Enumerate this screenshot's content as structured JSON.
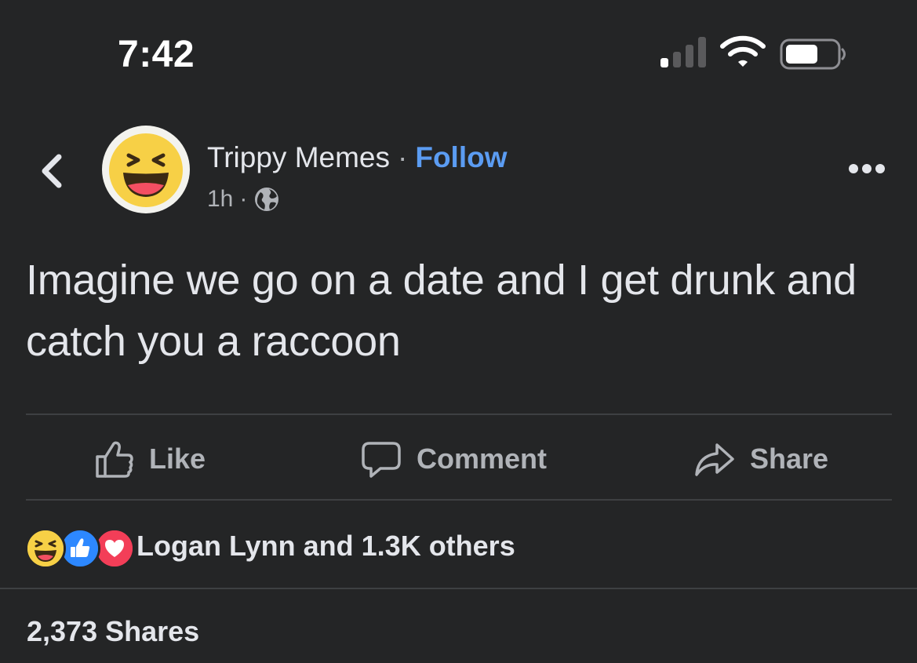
{
  "status_bar": {
    "time": "7:42",
    "icons": [
      "cellular-signal-icon",
      "wifi-icon",
      "battery-icon"
    ]
  },
  "post": {
    "author": "Trippy Memes",
    "separator": "·",
    "follow_label": "Follow",
    "time": "1h",
    "meta_separator": "·",
    "privacy_icon": "globe-icon",
    "avatar_icon": "laughing-emoji-icon",
    "text": "Imagine we go on a date and I get drunk and catch you a raccoon"
  },
  "actions": {
    "like_label": "Like",
    "comment_label": "Comment",
    "share_label": "Share"
  },
  "reactions": {
    "types": [
      "haha-reaction-icon",
      "like-reaction-icon",
      "love-reaction-icon"
    ],
    "summary": "Logan Lynn and 1.3K others"
  },
  "shares": {
    "count_label": "2,373 Shares"
  },
  "colors": {
    "background": "#242526",
    "text_primary": "#e4e6eb",
    "text_secondary": "#b0b3b8",
    "link": "#5b9cf2",
    "divider": "#3e4042",
    "like_blue": "#1877f2",
    "love_red": "#f33e58",
    "haha_yellow": "#f7d046"
  }
}
